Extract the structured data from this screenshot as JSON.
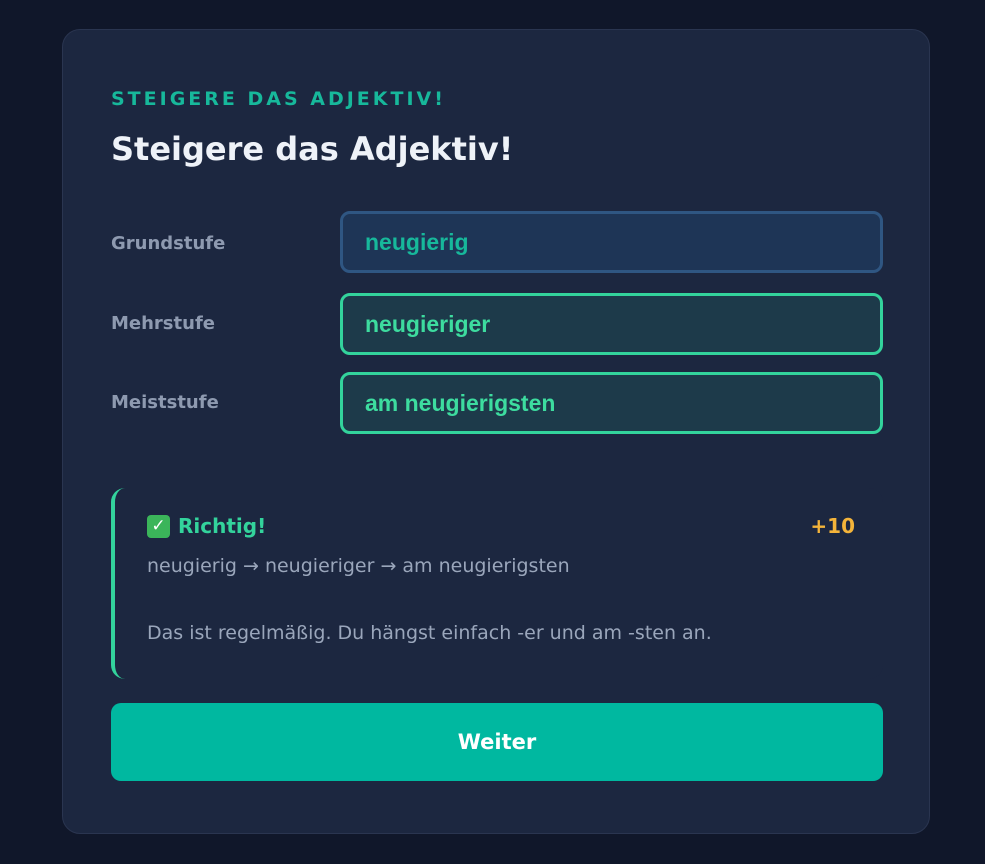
{
  "exercise": {
    "eyebrow": "STEIGERE DAS ADJEKTIV!",
    "title": "Steigere das Adjektiv!"
  },
  "rows": [
    {
      "label": "Grundstufe",
      "value": "neugierig"
    },
    {
      "label": "Mehrstufe",
      "value": "neugieriger"
    },
    {
      "label": "Meiststufe",
      "value": "am neugierigsten"
    }
  ],
  "feedback": {
    "icon": "check-icon",
    "title": "Richtig!",
    "points": "+10",
    "chain": "neugierig → neugieriger → am neugierigsten",
    "explanation": "Das ist regelmäßig. Du hängst einfach -er und am -sten an."
  },
  "actions": {
    "next_label": "Weiter"
  },
  "colors": {
    "accent": "#17b89b",
    "success": "#33d39c",
    "points": "#f4b43a",
    "button": "#00b8a0"
  }
}
